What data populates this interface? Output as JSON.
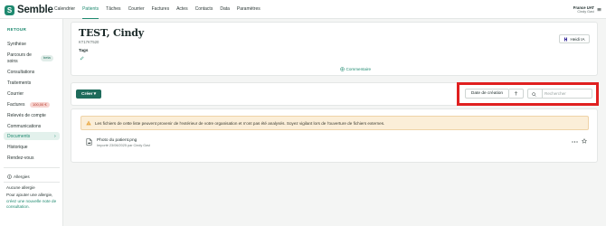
{
  "app": {
    "name": "Semble",
    "logo_letter": "S"
  },
  "nav": {
    "items": [
      {
        "label": "Calendrier",
        "active": false
      },
      {
        "label": "Patients",
        "active": true
      },
      {
        "label": "Tâches",
        "active": false
      },
      {
        "label": "Courrier",
        "active": false
      },
      {
        "label": "Factures",
        "active": false
      },
      {
        "label": "Actes",
        "active": false
      },
      {
        "label": "Contacts",
        "active": false
      },
      {
        "label": "Data",
        "active": false
      },
      {
        "label": "Paramètres",
        "active": false
      }
    ]
  },
  "user": {
    "org": "France UAT",
    "name": "Cindy Gavi"
  },
  "sidebar": {
    "back_label": "RETOUR",
    "items": [
      {
        "label": "Synthèse"
      },
      {
        "label": "Parcours de soins",
        "badge": "beta"
      },
      {
        "label": "Consultations"
      },
      {
        "label": "Traitements"
      },
      {
        "label": "Courrier"
      },
      {
        "label": "Factures",
        "badge": "100,00 €"
      },
      {
        "label": "Relevés de compte"
      },
      {
        "label": "Communications"
      },
      {
        "label": "Documents",
        "active": true
      },
      {
        "label": "Historique"
      },
      {
        "label": "Rendez-vous"
      }
    ],
    "allergies": {
      "title": "Allergies",
      "none": "Aucune allergie",
      "help_prefix": "Pour ajouter une allergie,",
      "help_link": "créez une nouvelle note de consultation.",
      "help_suffix": ""
    }
  },
  "patient": {
    "name": "TEST, Cindy",
    "id": "KT17KT520",
    "tags_label": "Tags",
    "heidi_label": "Heidi IA",
    "comment_label": "Commentaire"
  },
  "documents": {
    "create_label": "Créer",
    "sort_label": "Date de création",
    "search_placeholder": "Rechercher",
    "warning": "Les fichiers de cette liste peuvent provenir de l'extérieur de votre organisation et n'ont pas été analysés. Soyez vigilant lors de l'ouverture de fichiers externes.",
    "files": [
      {
        "name": "Photo du patient.png",
        "meta": "Importé 23/06/2025 par Cindy Gavi"
      }
    ]
  },
  "colors": {
    "accent": "#1f8a70",
    "primary_button": "#1e6b5b",
    "highlight": "#e02020",
    "warning_bg": "#fbeed8"
  }
}
